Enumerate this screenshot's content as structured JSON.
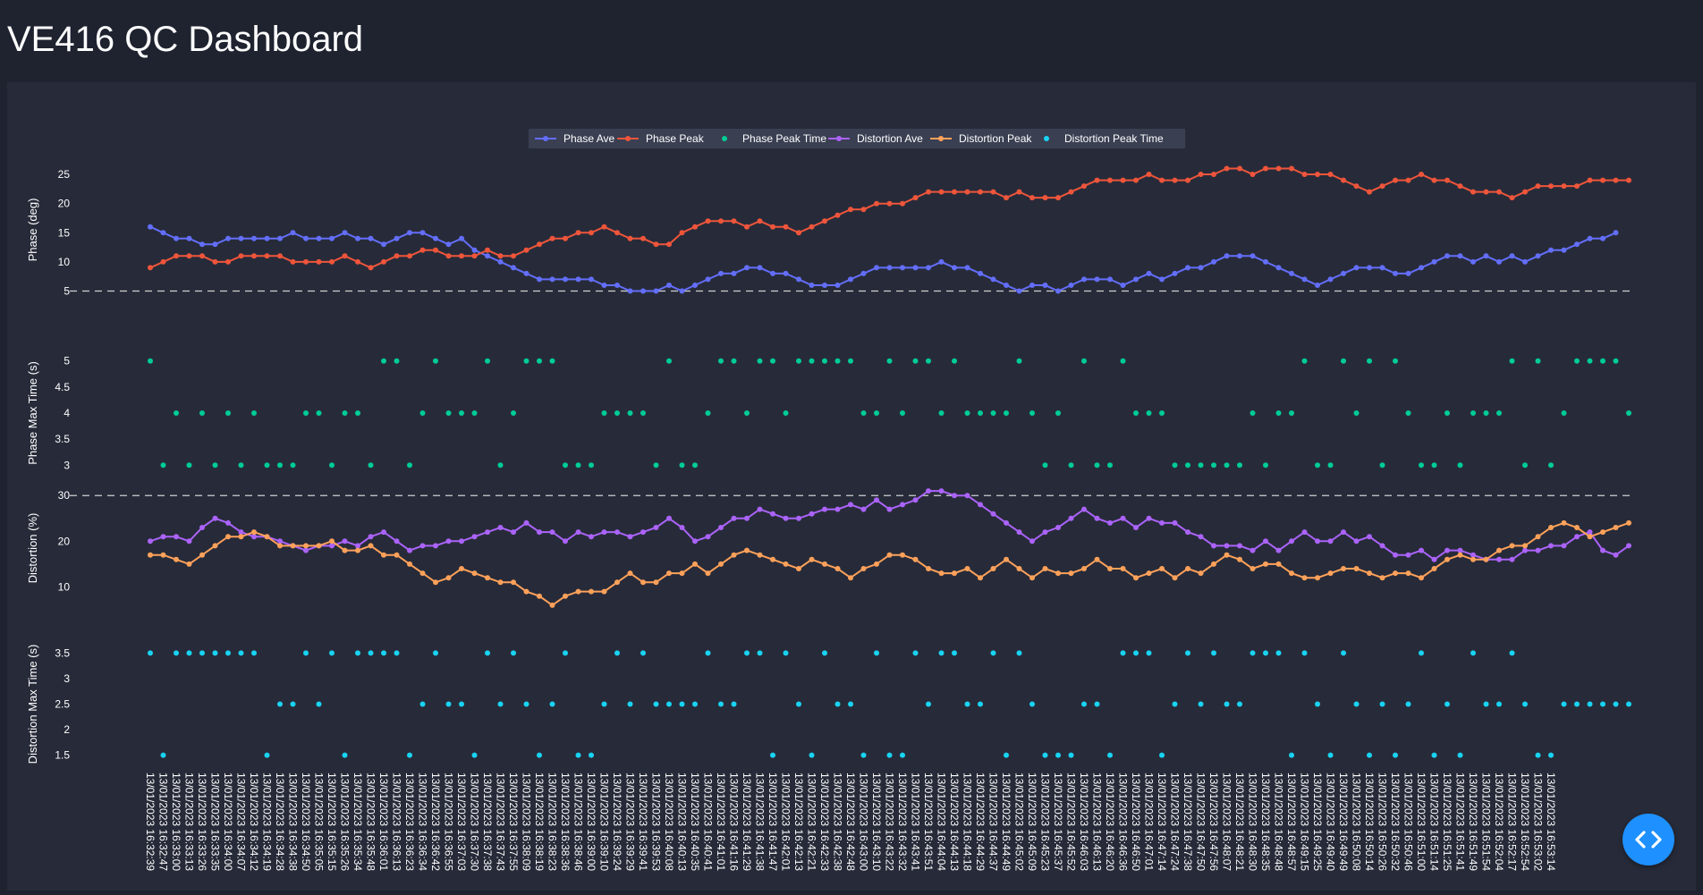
{
  "page": {
    "title": "VE416 QC Dashboard"
  },
  "colors": {
    "background": "#1f2330",
    "panel": "#272b39",
    "phase_ave": "#636efa",
    "phase_peak": "#ef553b",
    "phase_peak_time": "#00cc96",
    "distortion_ave": "#ab63fa",
    "distortion_peak": "#ffa15a",
    "distortion_peak_time": "#19d3f3",
    "fab": "#1e90ff"
  },
  "fab": {
    "icon": "code-brackets-icon"
  },
  "chart_data": {
    "type": "line",
    "legend": [
      "Phase Ave",
      "Phase Peak",
      "Phase Peak Time",
      "Distortion Ave",
      "Distortion Peak",
      "Distortion Peak Time"
    ],
    "legend_placement": "top-center",
    "grid": false,
    "x_timestamps": [
      "13/01/2023 16:32:39",
      "13/01/2023 16:32:47",
      "13/01/2023 16:33:00",
      "13/01/2023 16:33:13",
      "13/01/2023 16:33:26",
      "13/01/2023 16:33:35",
      "13/01/2023 16:34:00",
      "13/01/2023 16:34:07",
      "13/01/2023 16:34:12",
      "13/01/2023 16:34:19",
      "13/01/2023 16:34:28",
      "13/01/2023 16:34:38",
      "13/01/2023 16:34:50",
      "13/01/2023 16:35:05",
      "13/01/2023 16:35:15",
      "13/01/2023 16:35:26",
      "13/01/2023 16:35:34",
      "13/01/2023 16:35:48",
      "13/01/2023 16:36:01",
      "13/01/2023 16:36:13",
      "13/01/2023 16:36:23",
      "13/01/2023 16:36:34",
      "13/01/2023 16:36:42",
      "13/01/2023 16:36:55",
      "13/01/2023 16:37:03",
      "13/01/2023 16:37:30",
      "13/01/2023 16:37:38",
      "13/01/2023 16:37:43",
      "13/01/2023 16:37:55",
      "13/01/2023 16:38:09",
      "13/01/2023 16:38:19",
      "13/01/2023 16:38:23",
      "13/01/2023 16:38:36",
      "13/01/2023 16:38:46",
      "13/01/2023 16:39:00",
      "13/01/2023 16:39:10",
      "13/01/2023 16:39:24",
      "13/01/2023 16:39:29",
      "13/01/2023 16:39:41",
      "13/01/2023 16:39:53",
      "13/01/2023 16:40:08",
      "13/01/2023 16:40:13",
      "13/01/2023 16:40:35",
      "13/01/2023 16:40:41",
      "13/01/2023 16:41:01",
      "13/01/2023 16:41:16",
      "13/01/2023 16:41:29",
      "13/01/2023 16:41:38",
      "13/01/2023 16:41:47",
      "13/01/2023 16:42:01",
      "13/01/2023 16:42:13",
      "13/01/2023 16:42:21",
      "13/01/2023 16:42:33",
      "13/01/2023 16:42:38",
      "13/01/2023 16:42:48",
      "13/01/2023 16:43:00",
      "13/01/2023 16:43:10",
      "13/01/2023 16:43:22",
      "13/01/2023 16:43:32",
      "13/01/2023 16:43:41",
      "13/01/2023 16:43:51",
      "13/01/2023 16:44:04",
      "13/01/2023 16:44:13",
      "13/01/2023 16:44:18",
      "13/01/2023 16:44:29",
      "13/01/2023 16:44:37",
      "13/01/2023 16:44:49",
      "13/01/2023 16:45:02",
      "13/01/2023 16:45:09",
      "13/01/2023 16:45:23",
      "13/01/2023 16:45:37",
      "13/01/2023 16:45:52",
      "13/01/2023 16:46:03",
      "13/01/2023 16:46:13",
      "13/01/2023 16:46:20",
      "13/01/2023 16:46:36",
      "13/01/2023 16:46:50",
      "13/01/2023 16:47:01",
      "13/01/2023 16:47:14",
      "13/01/2023 16:47:24",
      "13/01/2023 16:47:38",
      "13/01/2023 16:47:50",
      "13/01/2023 16:47:56",
      "13/01/2023 16:48:07",
      "13/01/2023 16:48:21",
      "13/01/2023 16:48:30",
      "13/01/2023 16:48:35",
      "13/01/2023 16:48:48",
      "13/01/2023 16:48:57",
      "13/01/2023 16:49:15",
      "13/01/2023 16:49:25",
      "13/01/2023 16:49:40",
      "13/01/2023 16:49:49",
      "13/01/2023 16:50:08",
      "13/01/2023 16:50:14",
      "13/01/2023 16:50:26",
      "13/01/2023 16:50:32",
      "13/01/2023 16:50:46",
      "13/01/2023 16:51:00",
      "13/01/2023 16:51:14",
      "13/01/2023 16:51:25",
      "13/01/2023 16:51:41",
      "13/01/2023 16:51:49",
      "13/01/2023 16:51:54",
      "13/01/2023 16:52:04",
      "13/01/2023 16:52:17",
      "13/01/2023 16:52:54",
      "13/01/2023 16:53:02",
      "13/01/2023 16:53:14"
    ],
    "subplots": [
      {
        "ylabel": "Phase (deg)",
        "y_ticks": [
          5,
          10,
          15,
          20,
          25
        ],
        "ylim": [
          4,
          27
        ],
        "threshold": 5,
        "series": [
          {
            "name": "Phase Ave",
            "mode": "lines+markers",
            "values": [
              16,
              15,
              14,
              14,
              13,
              13,
              14,
              14,
              14,
              14,
              14,
              15,
              14,
              14,
              14,
              15,
              14,
              14,
              13,
              14,
              15,
              15,
              14,
              13,
              14,
              12,
              11,
              10,
              9,
              8,
              7,
              7,
              7,
              7,
              7,
              6,
              6,
              5,
              5,
              5,
              6,
              5,
              6,
              7,
              8,
              8,
              9,
              9,
              8,
              8,
              7,
              6,
              6,
              6,
              7,
              8,
              9,
              9,
              9,
              9,
              9,
              10,
              9,
              9,
              8,
              7,
              6,
              5,
              6,
              6,
              5,
              6,
              7,
              7,
              7,
              6,
              7,
              8,
              7,
              8,
              9,
              9,
              10,
              11,
              11,
              11,
              10,
              9,
              8,
              7,
              6,
              7,
              8,
              9,
              9,
              9,
              8,
              8,
              9,
              10,
              11,
              11,
              10,
              11,
              10,
              11,
              10,
              11,
              12,
              12,
              13,
              14,
              14,
              15
            ]
          },
          {
            "name": "Phase Peak",
            "mode": "lines+markers",
            "values": [
              9,
              10,
              11,
              11,
              11,
              10,
              10,
              11,
              11,
              11,
              11,
              10,
              10,
              10,
              10,
              11,
              10,
              9,
              10,
              11,
              11,
              12,
              12,
              11,
              11,
              11,
              12,
              11,
              11,
              12,
              13,
              14,
              14,
              15,
              15,
              16,
              15,
              14,
              14,
              13,
              13,
              15,
              16,
              17,
              17,
              17,
              16,
              17,
              16,
              16,
              15,
              16,
              17,
              18,
              19,
              19,
              20,
              20,
              20,
              21,
              22,
              22,
              22,
              22,
              22,
              22,
              21,
              22,
              21,
              21,
              21,
              22,
              23,
              24,
              24,
              24,
              24,
              25,
              24,
              24,
              24,
              25,
              25,
              26,
              26,
              25,
              26,
              26,
              26,
              25,
              25,
              25,
              24,
              23,
              22,
              23,
              24,
              24,
              25,
              24,
              24,
              23,
              22,
              22,
              22,
              21,
              22,
              23,
              23,
              23,
              23,
              24,
              24,
              24,
              24
            ]
          }
        ]
      },
      {
        "ylabel": "Phase Max Time (s)",
        "y_ticks": [
          3,
          3.5,
          4,
          4.5,
          5
        ],
        "ylim": [
          2.8,
          5.2
        ],
        "series": [
          {
            "name": "Phase Peak Time",
            "mode": "markers",
            "values": [
              5,
              3,
              4,
              3,
              4,
              3,
              4,
              3,
              4,
              3,
              3,
              3,
              4,
              4,
              3,
              4,
              4,
              3,
              5,
              5,
              3,
              4,
              5,
              4,
              4,
              4,
              5,
              3,
              4,
              5,
              5,
              5,
              3,
              3,
              3,
              4,
              4,
              4,
              4,
              3,
              5,
              3,
              3,
              4,
              5,
              5,
              4,
              5,
              5,
              4,
              5,
              5,
              5,
              5,
              5,
              4,
              4,
              5,
              4,
              5,
              5,
              4,
              5,
              4,
              4,
              4,
              4,
              5,
              4,
              3,
              4,
              3,
              5,
              3,
              3,
              5,
              4,
              4,
              4,
              3,
              3,
              3,
              3,
              3,
              3,
              4,
              3,
              4,
              4,
              5,
              3,
              3,
              5,
              4,
              5,
              3,
              5,
              4,
              3,
              3,
              4,
              3,
              4,
              4,
              4,
              5,
              3,
              5,
              3,
              4,
              5,
              5,
              5,
              5,
              4
            ]
          }
        ]
      },
      {
        "ylabel": "Distortion (%)",
        "y_ticks": [
          10,
          20,
          30
        ],
        "ylim": [
          5,
          32
        ],
        "threshold": 30,
        "series": [
          {
            "name": "Distortion Ave",
            "mode": "lines+markers",
            "values": [
              20,
              21,
              21,
              20,
              23,
              25,
              24,
              22,
              21,
              21,
              20,
              19,
              18,
              19,
              19,
              20,
              19,
              21,
              22,
              20,
              18,
              19,
              19,
              20,
              20,
              21,
              22,
              23,
              22,
              24,
              22,
              22,
              20,
              22,
              21,
              22,
              22,
              21,
              22,
              23,
              25,
              23,
              20,
              21,
              23,
              25,
              25,
              27,
              26,
              25,
              25,
              26,
              27,
              27,
              28,
              27,
              29,
              27,
              28,
              29,
              31,
              31,
              30,
              30,
              28,
              26,
              24,
              22,
              20,
              22,
              23,
              25,
              27,
              25,
              24,
              25,
              23,
              25,
              24,
              24,
              22,
              21,
              19,
              19,
              19,
              18,
              20,
              18,
              20,
              22,
              20,
              20,
              22,
              20,
              21,
              19,
              17,
              17,
              18,
              16,
              18,
              18,
              17,
              16,
              16,
              16,
              18,
              18,
              19,
              19,
              21,
              22,
              18,
              17,
              19
            ]
          },
          {
            "name": "Distortion Peak",
            "mode": "lines+markers",
            "values": [
              17,
              17,
              16,
              15,
              17,
              19,
              21,
              21,
              22,
              21,
              19,
              19,
              19,
              19,
              20,
              18,
              18,
              19,
              17,
              17,
              15,
              13,
              11,
              12,
              14,
              13,
              12,
              11,
              11,
              9,
              8,
              6,
              8,
              9,
              9,
              9,
              11,
              13,
              11,
              11,
              13,
              13,
              15,
              13,
              15,
              17,
              18,
              17,
              16,
              15,
              14,
              16,
              15,
              14,
              12,
              14,
              15,
              17,
              17,
              16,
              14,
              13,
              13,
              14,
              12,
              14,
              16,
              14,
              12,
              14,
              13,
              13,
              14,
              16,
              14,
              14,
              12,
              13,
              14,
              12,
              14,
              13,
              15,
              17,
              16,
              14,
              15,
              15,
              13,
              12,
              12,
              13,
              14,
              14,
              13,
              12,
              13,
              13,
              12,
              14,
              16,
              17,
              16,
              16,
              18,
              19,
              19,
              21,
              23,
              24,
              23,
              21,
              22,
              23,
              24
            ]
          }
        ]
      },
      {
        "ylabel": "Distortion Max Time (s)",
        "y_ticks": [
          1.5,
          2,
          2.5,
          3,
          3.5
        ],
        "ylim": [
          1.3,
          3.7
        ],
        "series": [
          {
            "name": "Distortion Peak Time",
            "mode": "markers",
            "values": [
              3.5,
              1.5,
              3.5,
              3.5,
              3.5,
              3.5,
              3.5,
              3.5,
              3.5,
              1.5,
              2.5,
              2.5,
              3.5,
              2.5,
              3.5,
              1.5,
              3.5,
              3.5,
              3.5,
              3.5,
              1.5,
              2.5,
              3.5,
              2.5,
              2.5,
              1.5,
              3.5,
              2.5,
              3.5,
              2.5,
              1.5,
              2.5,
              3.5,
              1.5,
              1.5,
              2.5,
              3.5,
              2.5,
              3.5,
              2.5,
              2.5,
              2.5,
              2.5,
              3.5,
              2.5,
              2.5,
              3.5,
              3.5,
              1.5,
              3.5,
              2.5,
              1.5,
              3.5,
              2.5,
              2.5,
              1.5,
              3.5,
              1.5,
              1.5,
              3.5,
              2.5,
              3.5,
              3.5,
              2.5,
              2.5,
              3.5,
              1.5,
              3.5,
              2.5,
              1.5,
              1.5,
              1.5,
              2.5,
              2.5,
              1.5,
              3.5,
              3.5,
              3.5,
              1.5,
              2.5,
              3.5,
              2.5,
              3.5,
              2.5,
              2.5,
              3.5,
              3.5,
              3.5,
              1.5,
              3.5,
              2.5,
              1.5,
              3.5,
              2.5,
              1.5,
              2.5,
              1.5,
              2.5,
              3.5,
              1.5,
              2.5,
              1.5,
              3.5,
              2.5,
              2.5,
              3.5,
              2.5,
              1.5,
              1.5,
              2.5,
              2.5,
              2.5,
              2.5,
              2.5,
              2.5
            ]
          }
        ]
      }
    ]
  }
}
